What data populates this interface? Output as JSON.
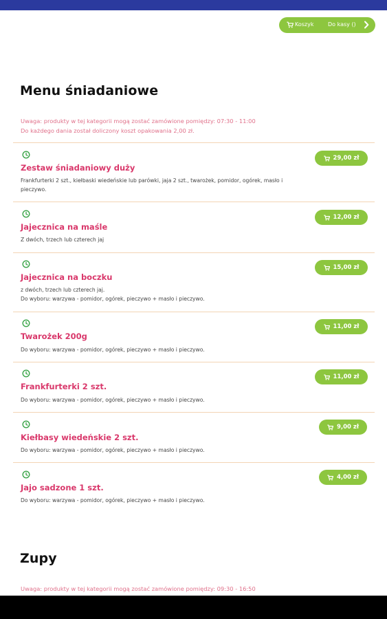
{
  "header": {
    "cart_label": "Koszyk",
    "checkout_label": "Do kasy ()",
    "accent_color": "#8dc63f",
    "topbar_color": "#2b3a9e"
  },
  "sections": [
    {
      "title": "Menu śniadaniowe",
      "notice_lines": [
        "Uwaga: produkty w tej kategorii mogą zostać zamówione pomiędzy: 07:30 - 11:00",
        "Do każdego dania został doliczony koszt opakowania 2,00 zł."
      ],
      "items": [
        {
          "name": "Zestaw śniadaniowy duży",
          "description": "Frankfurterki 2 szt., kiełbaski wiedeńskie lub parówki, jaja 2 szt., twarożek, pomidor, ogórek, masło i pieczywo.",
          "price": "29,00 zł"
        },
        {
          "name": "Jajecznica na maśle",
          "description": "Z dwóch, trzech lub czterech jaj",
          "price": "12,00 zł"
        },
        {
          "name": "Jajecznica na boczku",
          "description": "z dwóch, trzech lub czterech jaj.\nDo wyboru: warzywa - pomidor, ogórek, pieczywo + masło i pieczywo.",
          "price": "15,00 zł"
        },
        {
          "name": "Twarożek 200g",
          "description": "Do wyboru: warzywa - pomidor, ogórek, pieczywo + masło i pieczywo.",
          "price": "11,00 zł"
        },
        {
          "name": "Frankfurterki 2 szt.",
          "description": "Do wyboru: warzywa - pomidor, ogórek, pieczywo + masło i pieczywo.",
          "price": "11,00 zł"
        },
        {
          "name": "Kiełbasy wiedeńskie 2 szt.",
          "description": "Do wyboru: warzywa - pomidor, ogórek, pieczywo + masło i pieczywo.",
          "price": "9,00 zł"
        },
        {
          "name": "Jajo sadzone 1 szt.",
          "description": "Do wyboru: warzywa - pomidor, ogórek, pieczywo + masło i pieczywo.",
          "price": "4,00 zł"
        }
      ]
    },
    {
      "title": "Zupy",
      "notice_lines": [
        "Uwaga: produkty w tej kategorii mogą zostać zamówione pomiędzy: 09:30 - 16:50"
      ],
      "items": []
    }
  ]
}
